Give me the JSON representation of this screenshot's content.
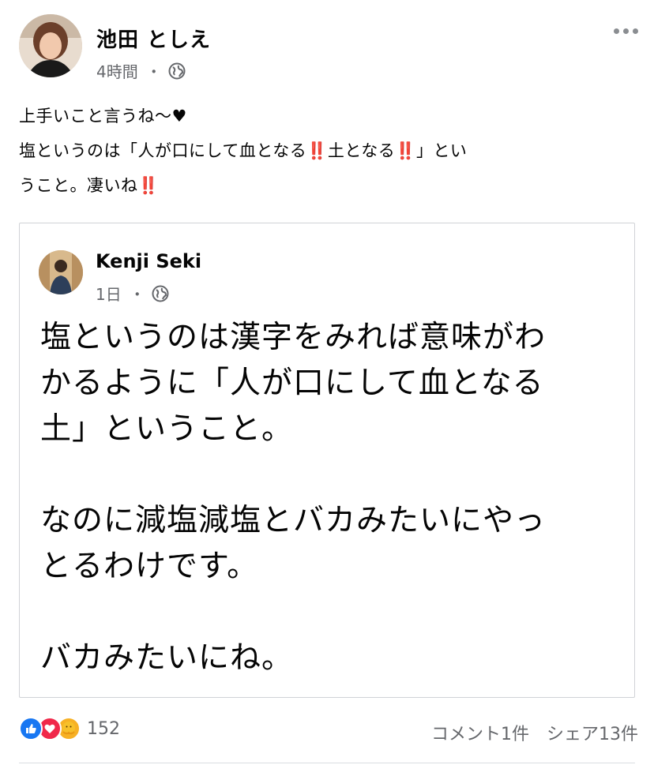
{
  "post": {
    "author": "池田 としえ",
    "time": "4時間",
    "separator": "・",
    "privacy_icon": "globe-icon",
    "more_icon": "more-options-icon",
    "text_line1": "上手いこと言うね〜♥",
    "text_line2_a": "塩というのは「人が口にして血となる",
    "text_line2_b": "土となる",
    "text_line2_c": "」とい",
    "text_line3_a": "うこと。凄いね",
    "double_bang": "‼️"
  },
  "shared_post": {
    "author": "Kenji Seki",
    "time": "1日",
    "separator": "・",
    "privacy_icon": "globe-icon",
    "body_line1": "塩というのは漢字をみれば意味がわ",
    "body_line2": "かるように「人が口にして血となる",
    "body_line3": "土」ということ。",
    "body_line4": "なのに減塩減塩とバカみたいにやっ",
    "body_line5": "とるわけです。",
    "body_line6": "バカみたいにね。"
  },
  "footer": {
    "reaction_icons": [
      "like-icon",
      "love-icon",
      "care-icon"
    ],
    "reaction_count": "152",
    "comments": "コメント1件",
    "shares": "シェア13件"
  },
  "colors": {
    "like": "#1877f2",
    "love": "#f0284a",
    "care": "#f7b125",
    "secondary_text": "#65676b",
    "bang": "#d0161d"
  }
}
